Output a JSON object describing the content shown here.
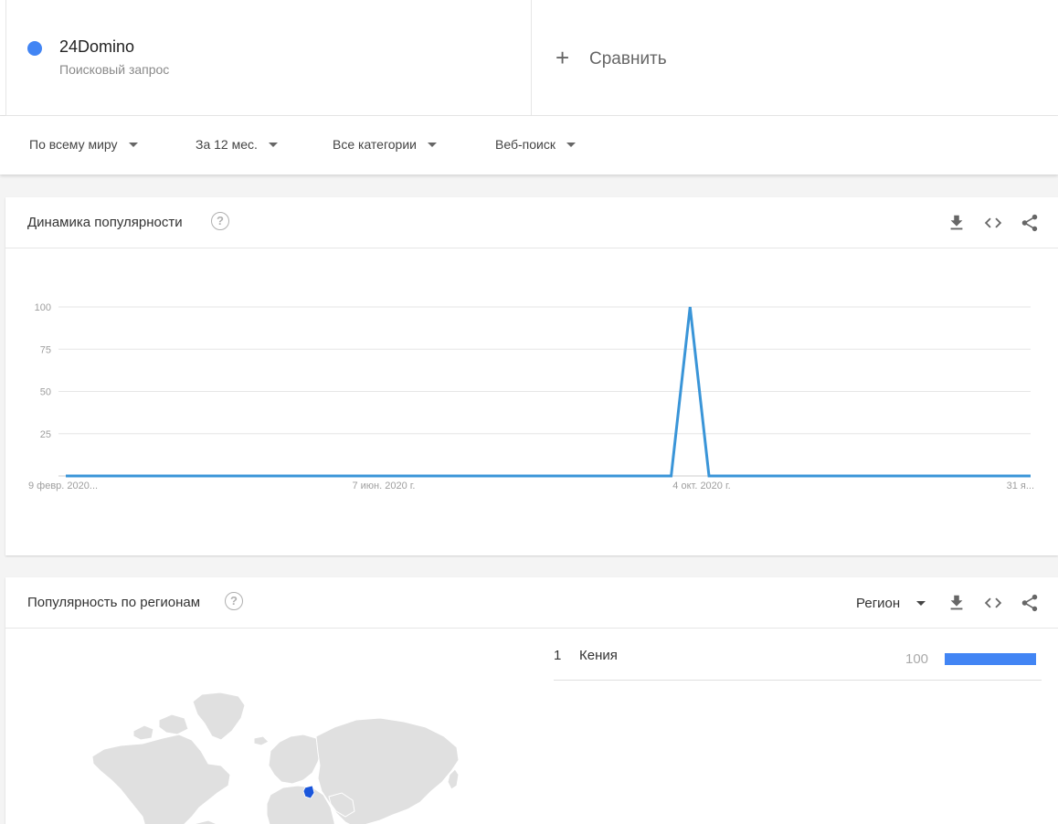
{
  "search_term": {
    "name": "24Domino",
    "type": "Поисковый запрос",
    "color": "#4285f4"
  },
  "compare": {
    "label": "Сравнить",
    "icon": "plus-icon"
  },
  "filters": [
    {
      "label": "По всему миру"
    },
    {
      "label": "За 12 мес."
    },
    {
      "label": "Все категории"
    },
    {
      "label": "Веб-поиск"
    }
  ],
  "interest_over_time": {
    "title": "Динамика популярности",
    "help_icon": "?",
    "tools": [
      "download-icon",
      "embed-icon",
      "share-icon"
    ]
  },
  "chart_data": {
    "type": "line",
    "title": "",
    "xlabel": "",
    "ylabel": "",
    "ylim": [
      0,
      100
    ],
    "yticks": [
      25,
      50,
      75,
      100
    ],
    "xtick_labels": [
      "9 февр. 2020...",
      "7 июн. 2020 г.",
      "4 окт. 2020 г.",
      "31 я..."
    ],
    "grid": true,
    "series": [
      {
        "color": "#3a95d8",
        "x": [
          "2020-02-09",
          "2020-09-20",
          "2020-09-27",
          "2020-10-04",
          "2021-01-31"
        ],
        "values": [
          0,
          0,
          100,
          0,
          0
        ]
      }
    ]
  },
  "interest_by_region": {
    "title": "Популярность по регионам",
    "help_icon": "?",
    "resolution": "Регион",
    "tools": [
      "download-icon",
      "embed-icon",
      "share-icon"
    ],
    "highlight_color": "#1a56db",
    "rows": [
      {
        "rank": "1",
        "name": "Кения",
        "value": "100",
        "fraction": 1.0
      }
    ]
  }
}
